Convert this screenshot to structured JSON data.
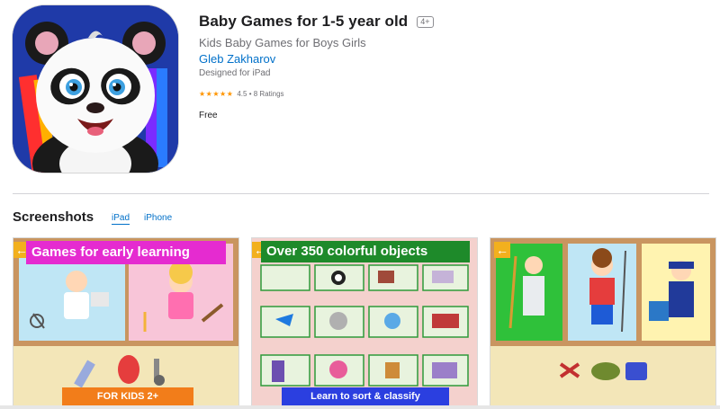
{
  "app": {
    "title": "Baby Games for 1-5 year old",
    "age_rating": "4+",
    "subtitle": "Kids Baby Games for Boys Girls",
    "developer": "Gleb Zakharov",
    "designed_for": "Designed for iPad",
    "rating_value": 4.5,
    "rating_text": "4.5 • 8 Ratings",
    "price": "Free",
    "icon": "panda-app-icon"
  },
  "screenshots_section": {
    "title": "Screenshots",
    "tabs": [
      {
        "label": "iPad",
        "selected": true
      },
      {
        "label": "iPhone",
        "selected": false
      }
    ]
  },
  "screenshots": [
    {
      "banner": "Games for early learning",
      "footer": "FOR KIDS 2+"
    },
    {
      "banner": "Over 350 colorful objects",
      "footer": "Learn to sort & classify"
    },
    {
      "banner": "",
      "footer": ""
    }
  ],
  "colors": {
    "link": "#0070c9",
    "stars": "#ff9500",
    "banner_pink": "#e52bd0",
    "banner_green": "#1e8a2a",
    "footer_orange": "#f27d1a",
    "footer_blue": "#2b3fe0"
  }
}
